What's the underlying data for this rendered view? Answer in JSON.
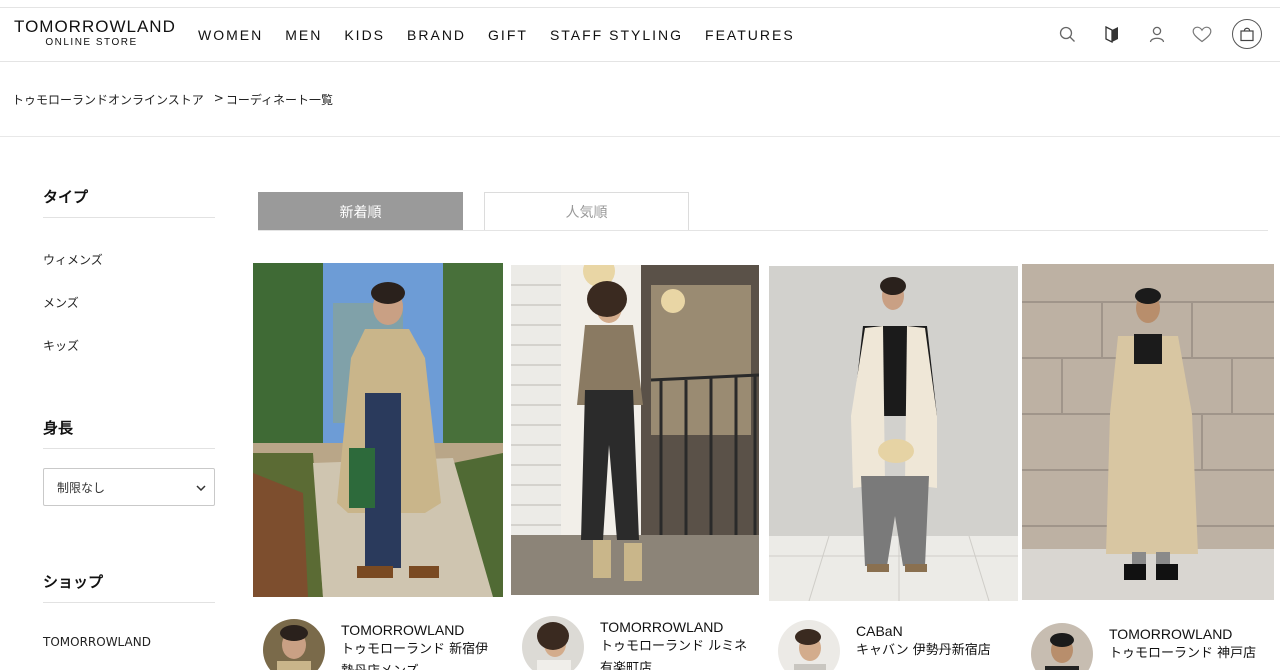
{
  "header": {
    "logo_main": "TOMORROWLAND",
    "logo_sub": "ONLINE STORE",
    "nav": [
      "WOMEN",
      "MEN",
      "KIDS",
      "BRAND",
      "GIFT",
      "STAFF STYLING",
      "FEATURES"
    ],
    "icons": [
      "search-icon",
      "beginner-mark-icon",
      "user-icon",
      "heart-icon",
      "shopping-bag-icon"
    ]
  },
  "breadcrumb": {
    "home": "トゥモローランドオンラインストア",
    "separator": ">",
    "current": "コーディネート一覧"
  },
  "sidebar": {
    "type_heading": "タイプ",
    "type_items": [
      "ウィメンズ",
      "メンズ",
      "キッズ"
    ],
    "height_heading": "身長",
    "height_select_value": "制限なし",
    "shop_heading": "ショップ",
    "shop_items": [
      "TOMORROWLAND"
    ]
  },
  "sort_tabs": {
    "active": "新着順",
    "inactive": "人気順",
    "active_color": "#9a9a9a"
  },
  "coordinates": [
    {
      "brand": "TOMORROWLAND",
      "shop_line1": "トゥモローランド 新宿伊",
      "shop_line2": "勢丹店メンズ"
    },
    {
      "brand": "TOMORROWLAND",
      "shop_line1": "トゥモローランド ルミネ",
      "shop_line2": "有楽町店"
    },
    {
      "brand": "CABaN",
      "shop_line1": "キャバン 伊勢丹新宿店",
      "shop_line2": ""
    },
    {
      "brand": "TOMORROWLAND",
      "shop_line1": "トゥモローランド 神戸店",
      "shop_line2": ""
    }
  ]
}
